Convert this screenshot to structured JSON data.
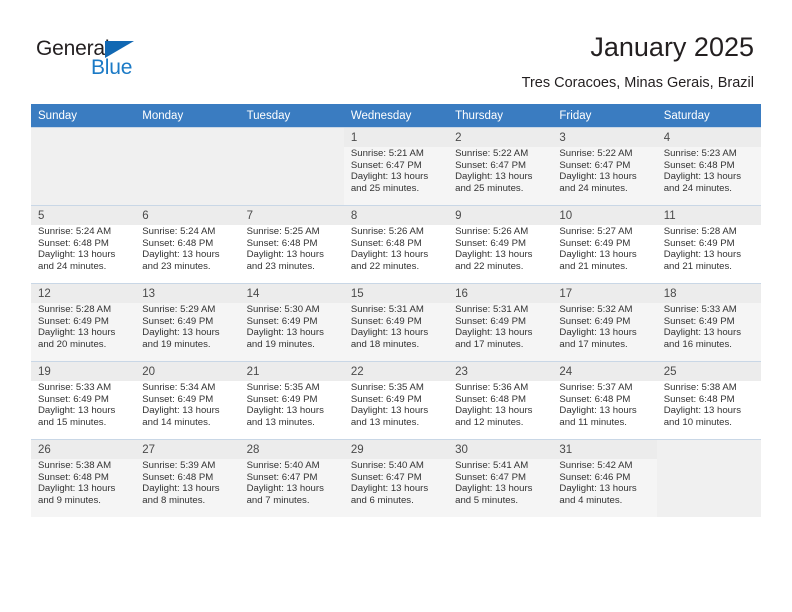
{
  "brand": {
    "name_part1": "General",
    "name_part2": "Blue",
    "triangle_color": "#1168b3",
    "blue_color": "#1b7ac6"
  },
  "header": {
    "month_title": "January 2025",
    "location": "Tres Coracoes, Minas Gerais, Brazil",
    "header_bg_color": "#3a7cc1"
  },
  "calendar": {
    "weekday_headers": [
      "Sunday",
      "Monday",
      "Tuesday",
      "Wednesday",
      "Thursday",
      "Friday",
      "Saturday"
    ],
    "labels": {
      "sunrise": "Sunrise:",
      "sunset": "Sunset:",
      "daylight": "Daylight:"
    },
    "weeks": [
      [
        {
          "day": "",
          "empty": true
        },
        {
          "day": "",
          "empty": true
        },
        {
          "day": "",
          "empty": true
        },
        {
          "day": "1",
          "sunrise": "Sunrise: 5:21 AM",
          "sunset": "Sunset: 6:47 PM",
          "daylight_line1": "Daylight: 13 hours",
          "daylight_line2": "and 25 minutes."
        },
        {
          "day": "2",
          "sunrise": "Sunrise: 5:22 AM",
          "sunset": "Sunset: 6:47 PM",
          "daylight_line1": "Daylight: 13 hours",
          "daylight_line2": "and 25 minutes."
        },
        {
          "day": "3",
          "sunrise": "Sunrise: 5:22 AM",
          "sunset": "Sunset: 6:47 PM",
          "daylight_line1": "Daylight: 13 hours",
          "daylight_line2": "and 24 minutes."
        },
        {
          "day": "4",
          "sunrise": "Sunrise: 5:23 AM",
          "sunset": "Sunset: 6:48 PM",
          "daylight_line1": "Daylight: 13 hours",
          "daylight_line2": "and 24 minutes."
        }
      ],
      [
        {
          "day": "5",
          "sunrise": "Sunrise: 5:24 AM",
          "sunset": "Sunset: 6:48 PM",
          "daylight_line1": "Daylight: 13 hours",
          "daylight_line2": "and 24 minutes."
        },
        {
          "day": "6",
          "sunrise": "Sunrise: 5:24 AM",
          "sunset": "Sunset: 6:48 PM",
          "daylight_line1": "Daylight: 13 hours",
          "daylight_line2": "and 23 minutes."
        },
        {
          "day": "7",
          "sunrise": "Sunrise: 5:25 AM",
          "sunset": "Sunset: 6:48 PM",
          "daylight_line1": "Daylight: 13 hours",
          "daylight_line2": "and 23 minutes."
        },
        {
          "day": "8",
          "sunrise": "Sunrise: 5:26 AM",
          "sunset": "Sunset: 6:48 PM",
          "daylight_line1": "Daylight: 13 hours",
          "daylight_line2": "and 22 minutes."
        },
        {
          "day": "9",
          "sunrise": "Sunrise: 5:26 AM",
          "sunset": "Sunset: 6:49 PM",
          "daylight_line1": "Daylight: 13 hours",
          "daylight_line2": "and 22 minutes."
        },
        {
          "day": "10",
          "sunrise": "Sunrise: 5:27 AM",
          "sunset": "Sunset: 6:49 PM",
          "daylight_line1": "Daylight: 13 hours",
          "daylight_line2": "and 21 minutes."
        },
        {
          "day": "11",
          "sunrise": "Sunrise: 5:28 AM",
          "sunset": "Sunset: 6:49 PM",
          "daylight_line1": "Daylight: 13 hours",
          "daylight_line2": "and 21 minutes."
        }
      ],
      [
        {
          "day": "12",
          "sunrise": "Sunrise: 5:28 AM",
          "sunset": "Sunset: 6:49 PM",
          "daylight_line1": "Daylight: 13 hours",
          "daylight_line2": "and 20 minutes."
        },
        {
          "day": "13",
          "sunrise": "Sunrise: 5:29 AM",
          "sunset": "Sunset: 6:49 PM",
          "daylight_line1": "Daylight: 13 hours",
          "daylight_line2": "and 19 minutes."
        },
        {
          "day": "14",
          "sunrise": "Sunrise: 5:30 AM",
          "sunset": "Sunset: 6:49 PM",
          "daylight_line1": "Daylight: 13 hours",
          "daylight_line2": "and 19 minutes."
        },
        {
          "day": "15",
          "sunrise": "Sunrise: 5:31 AM",
          "sunset": "Sunset: 6:49 PM",
          "daylight_line1": "Daylight: 13 hours",
          "daylight_line2": "and 18 minutes."
        },
        {
          "day": "16",
          "sunrise": "Sunrise: 5:31 AM",
          "sunset": "Sunset: 6:49 PM",
          "daylight_line1": "Daylight: 13 hours",
          "daylight_line2": "and 17 minutes."
        },
        {
          "day": "17",
          "sunrise": "Sunrise: 5:32 AM",
          "sunset": "Sunset: 6:49 PM",
          "daylight_line1": "Daylight: 13 hours",
          "daylight_line2": "and 17 minutes."
        },
        {
          "day": "18",
          "sunrise": "Sunrise: 5:33 AM",
          "sunset": "Sunset: 6:49 PM",
          "daylight_line1": "Daylight: 13 hours",
          "daylight_line2": "and 16 minutes."
        }
      ],
      [
        {
          "day": "19",
          "sunrise": "Sunrise: 5:33 AM",
          "sunset": "Sunset: 6:49 PM",
          "daylight_line1": "Daylight: 13 hours",
          "daylight_line2": "and 15 minutes."
        },
        {
          "day": "20",
          "sunrise": "Sunrise: 5:34 AM",
          "sunset": "Sunset: 6:49 PM",
          "daylight_line1": "Daylight: 13 hours",
          "daylight_line2": "and 14 minutes."
        },
        {
          "day": "21",
          "sunrise": "Sunrise: 5:35 AM",
          "sunset": "Sunset: 6:49 PM",
          "daylight_line1": "Daylight: 13 hours",
          "daylight_line2": "and 13 minutes."
        },
        {
          "day": "22",
          "sunrise": "Sunrise: 5:35 AM",
          "sunset": "Sunset: 6:49 PM",
          "daylight_line1": "Daylight: 13 hours",
          "daylight_line2": "and 13 minutes."
        },
        {
          "day": "23",
          "sunrise": "Sunrise: 5:36 AM",
          "sunset": "Sunset: 6:48 PM",
          "daylight_line1": "Daylight: 13 hours",
          "daylight_line2": "and 12 minutes."
        },
        {
          "day": "24",
          "sunrise": "Sunrise: 5:37 AM",
          "sunset": "Sunset: 6:48 PM",
          "daylight_line1": "Daylight: 13 hours",
          "daylight_line2": "and 11 minutes."
        },
        {
          "day": "25",
          "sunrise": "Sunrise: 5:38 AM",
          "sunset": "Sunset: 6:48 PM",
          "daylight_line1": "Daylight: 13 hours",
          "daylight_line2": "and 10 minutes."
        }
      ],
      [
        {
          "day": "26",
          "sunrise": "Sunrise: 5:38 AM",
          "sunset": "Sunset: 6:48 PM",
          "daylight_line1": "Daylight: 13 hours",
          "daylight_line2": "and 9 minutes."
        },
        {
          "day": "27",
          "sunrise": "Sunrise: 5:39 AM",
          "sunset": "Sunset: 6:48 PM",
          "daylight_line1": "Daylight: 13 hours",
          "daylight_line2": "and 8 minutes."
        },
        {
          "day": "28",
          "sunrise": "Sunrise: 5:40 AM",
          "sunset": "Sunset: 6:47 PM",
          "daylight_line1": "Daylight: 13 hours",
          "daylight_line2": "and 7 minutes."
        },
        {
          "day": "29",
          "sunrise": "Sunrise: 5:40 AM",
          "sunset": "Sunset: 6:47 PM",
          "daylight_line1": "Daylight: 13 hours",
          "daylight_line2": "and 6 minutes."
        },
        {
          "day": "30",
          "sunrise": "Sunrise: 5:41 AM",
          "sunset": "Sunset: 6:47 PM",
          "daylight_line1": "Daylight: 13 hours",
          "daylight_line2": "and 5 minutes."
        },
        {
          "day": "31",
          "sunrise": "Sunrise: 5:42 AM",
          "sunset": "Sunset: 6:46 PM",
          "daylight_line1": "Daylight: 13 hours",
          "daylight_line2": "and 4 minutes."
        },
        {
          "day": "",
          "empty": true
        }
      ]
    ]
  }
}
